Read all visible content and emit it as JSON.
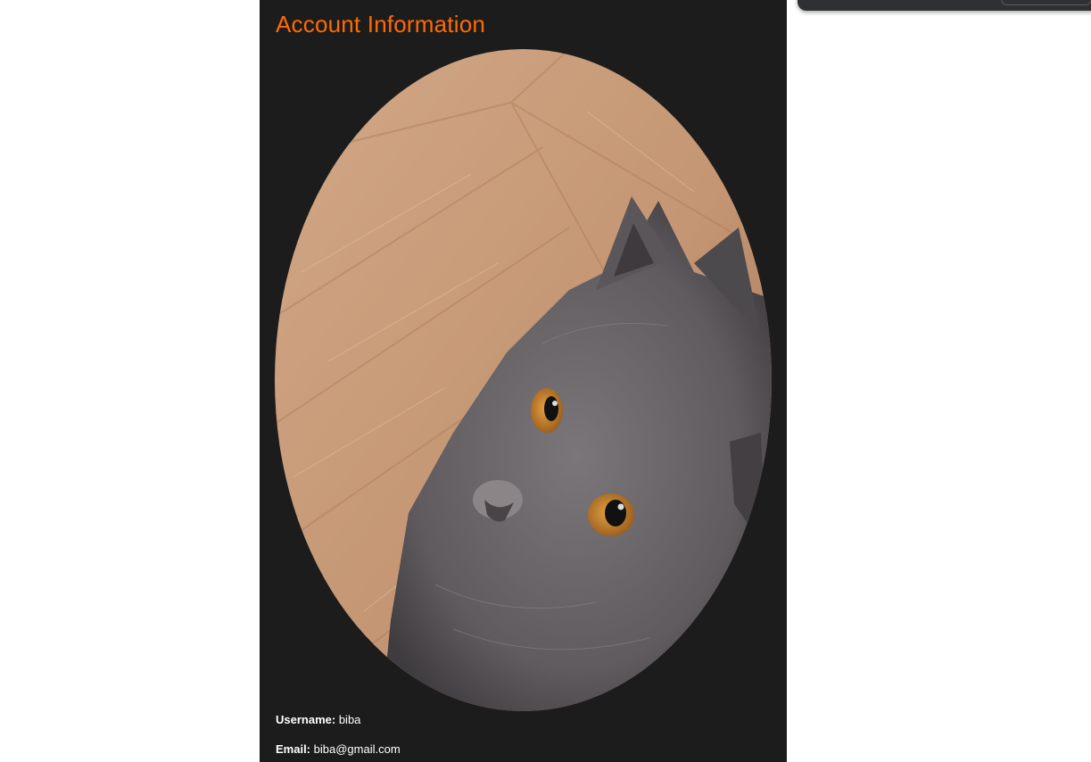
{
  "account": {
    "title": "Account Information",
    "avatar": {
      "subject": "grey kitten photo",
      "colors": {
        "floor": "#c49673",
        "floor_dark": "#a9785a",
        "fur": "#6f6b6f",
        "fur_dark": "#4a474b",
        "eye": "#c8862e",
        "pupil": "#111111"
      }
    },
    "username_label": "Username:",
    "username_value": "biba",
    "email_label": "Email:",
    "email_value": "biba@gmail.com"
  },
  "theme": {
    "panel_background": "#1c1c1c",
    "accent": "#ff6a00",
    "text": "#ffffff",
    "page_background": "#ffffff"
  }
}
